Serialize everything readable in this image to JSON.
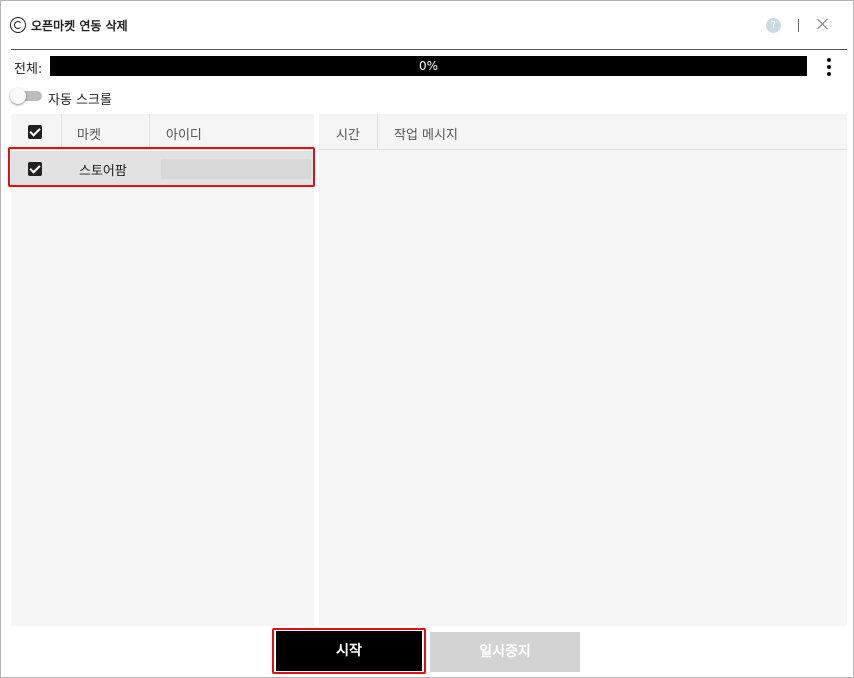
{
  "window": {
    "title": "오픈마켓 연동 삭제",
    "help_icon": "?"
  },
  "progress": {
    "label": "전체:",
    "percent": 0,
    "text": "0%"
  },
  "auto_scroll": {
    "label": "자동 스크롤",
    "enabled": false
  },
  "market_table": {
    "columns": [
      "마켓",
      "아이디"
    ],
    "rows": [
      {
        "checked": true,
        "market": "스토어팜",
        "id": ""
      }
    ]
  },
  "log_table": {
    "columns": [
      "시간",
      "작업 메시지"
    ],
    "rows": []
  },
  "buttons": {
    "start": "시작",
    "pause": "일시중지"
  },
  "colors": {
    "highlight": "#e01010",
    "primary": "#000000",
    "disabled": "#d3d3d3"
  }
}
